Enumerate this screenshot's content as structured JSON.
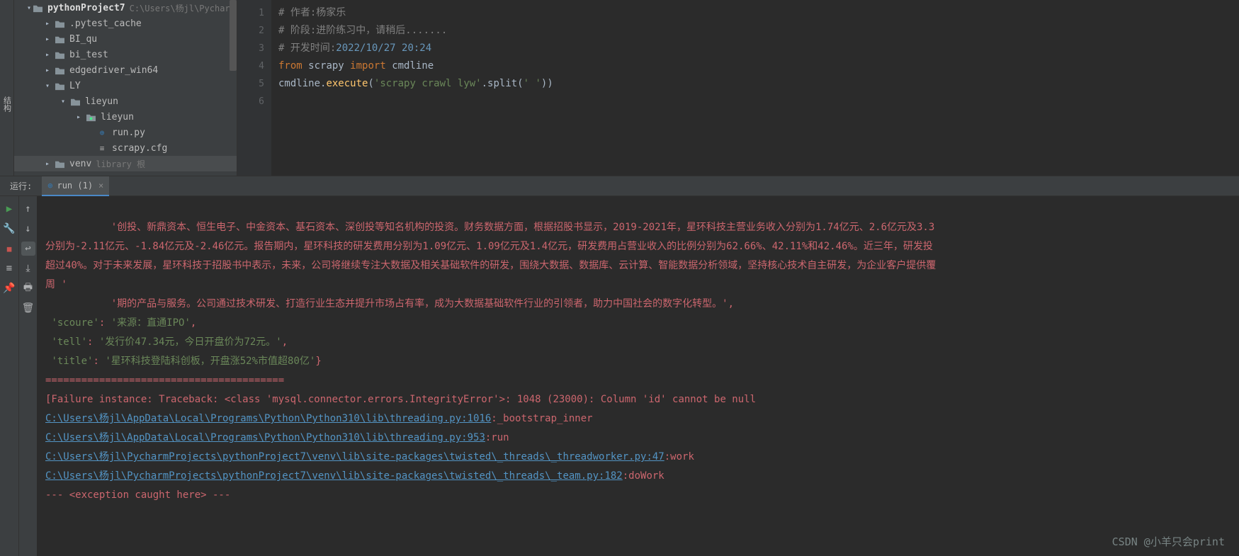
{
  "sidebar": {
    "struct": "结构"
  },
  "project": {
    "root": {
      "name": "pythonProject7",
      "path": "C:\\Users\\杨jl\\PycharmP"
    },
    "items": [
      {
        "name": ".pytest_cache",
        "indent": 40,
        "expand": false,
        "type": "folder"
      },
      {
        "name": "BI_qu",
        "indent": 40,
        "expand": false,
        "type": "folder"
      },
      {
        "name": "bi_test",
        "indent": 40,
        "expand": false,
        "type": "folder"
      },
      {
        "name": "edgedriver_win64",
        "indent": 40,
        "expand": false,
        "type": "folder"
      },
      {
        "name": "LY",
        "indent": 40,
        "expand": true,
        "type": "folder"
      },
      {
        "name": "lieyun",
        "indent": 62,
        "expand": true,
        "type": "folder"
      },
      {
        "name": "lieyun",
        "indent": 84,
        "expand": false,
        "type": "pkg"
      },
      {
        "name": "run.py",
        "indent": 100,
        "type": "py"
      },
      {
        "name": "scrapy.cfg",
        "indent": 100,
        "type": "cfg"
      },
      {
        "name": "venv",
        "indent": 40,
        "expand": false,
        "type": "folder",
        "suffix": "library 根",
        "sel": true
      }
    ]
  },
  "gutter": [
    "1",
    "2",
    "3",
    "4",
    "5",
    "6"
  ],
  "code": {
    "l1": "# 作者:杨家乐",
    "l2": "# 阶段:进阶练习中，请稍后.......",
    "l3a": "# 开发时间:",
    "l3b": "2022/10/27 20:24",
    "l4a": "from ",
    "l4b": "scrapy ",
    "l4c": "import ",
    "l4d": "cmdline",
    "l5a": "cmdline.",
    "l5b": "execute",
    "l5c": "(",
    "l5d": "'scrapy crawl lyw'",
    "l5e": ".split(",
    "l5f": "' '",
    "l5g": "))"
  },
  "run": {
    "label": "运行:",
    "tab": "run (1)"
  },
  "console": {
    "r1": "           '创投、新鼎资本、恒生电子、中金资本、基石资本、深创投等知名机构的投资。财务数据方面，根据招股书显示，2019-2021年，星环科技主营业务收入分别为1.74亿元、2.6亿元及3.3",
    "r2": "分别为-2.11亿元、-1.84亿元及-2.46亿元。报告期内，星环科技的研发费用分别为1.09亿元、1.09亿元及1.4亿元，研发费用占营业收入的比例分别为62.66%、42.11%和42.46%。近三年，研发投",
    "r3": "超过40%。对于未来发展，星环科技于招股书中表示，未来，公司将继续专注大数据及相关基础软件的研发，围绕大数据、数据库、云计算、智能数据分析领域，坚持核心技术自主研发，为企业客户提供覆",
    "r4": "周 '",
    "r5": "           '期的产品与服务。公司通过技术研发、打造行业生态并提升市场占有率，成为大数据基础软件行业的引领者，助力中国社会的数字化转型。',",
    "r6a": "'scoure'",
    "r6b": ": ",
    "r6c": "'来源：直通IPO'",
    "r6d": ",",
    "r7a": "'tell'",
    "r7b": ": ",
    "r7c": "'发行价47.34元，今日开盘价为72元。'",
    "r7d": ",",
    "r8a": "'title'",
    "r8b": ": ",
    "r8c": "'星环科技登陆科创板，开盘涨52%市值超80亿'",
    "r8d": "}",
    "r9": "========================================",
    "r10": "[Failure instance: Traceback: <class 'mysql.connector.errors.IntegrityError'>: 1048 (23000): Column 'id' cannot be null",
    "l1": "C:\\Users\\杨jl\\AppData\\Local\\Programs\\Python\\Python310\\lib\\threading.py:1016",
    "l1s": ":_bootstrap_inner",
    "l2": "C:\\Users\\杨jl\\AppData\\Local\\Programs\\Python\\Python310\\lib\\threading.py:953",
    "l2s": ":run",
    "l3": "C:\\Users\\杨jl\\PycharmProjects\\pythonProject7\\venv\\lib\\site-packages\\twisted\\_threads\\_threadworker.py:47",
    "l3s": ":work",
    "l4": "C:\\Users\\杨jl\\PycharmProjects\\pythonProject7\\venv\\lib\\site-packages\\twisted\\_threads\\_team.py:182",
    "l4s": ":doWork",
    "r15": "--- <exception caught here> ---"
  },
  "watermark": "CSDN @小羊只会print"
}
